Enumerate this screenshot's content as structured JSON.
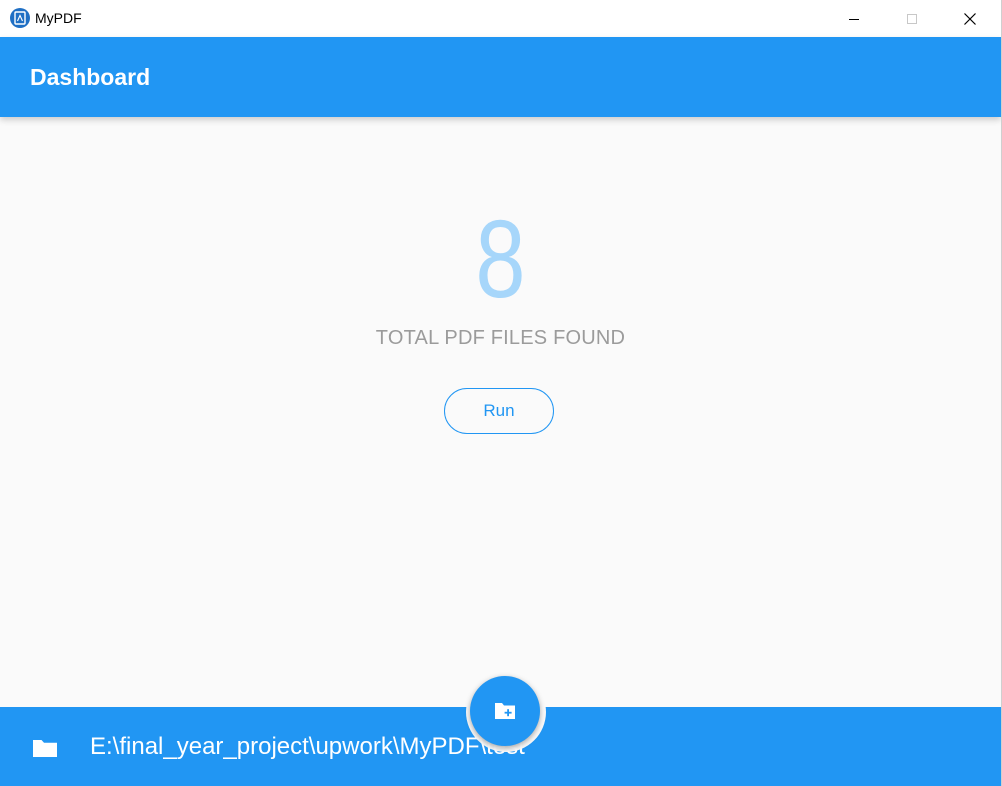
{
  "window": {
    "title": "MyPDF"
  },
  "appbar": {
    "title": "Dashboard"
  },
  "main": {
    "count": "8",
    "count_label": "TOTAL PDF FILES FOUND",
    "run_label": "Run"
  },
  "bottombar": {
    "path": "E:\\final_year_project\\upwork\\MyPDF\\test",
    "folder_icon": "folder-icon",
    "fab_icon": "create-new-folder-icon"
  },
  "colors": {
    "primary": "#2196f3",
    "count": "#a6d6fa",
    "label": "#9b9b9b",
    "background": "#fafafa"
  }
}
